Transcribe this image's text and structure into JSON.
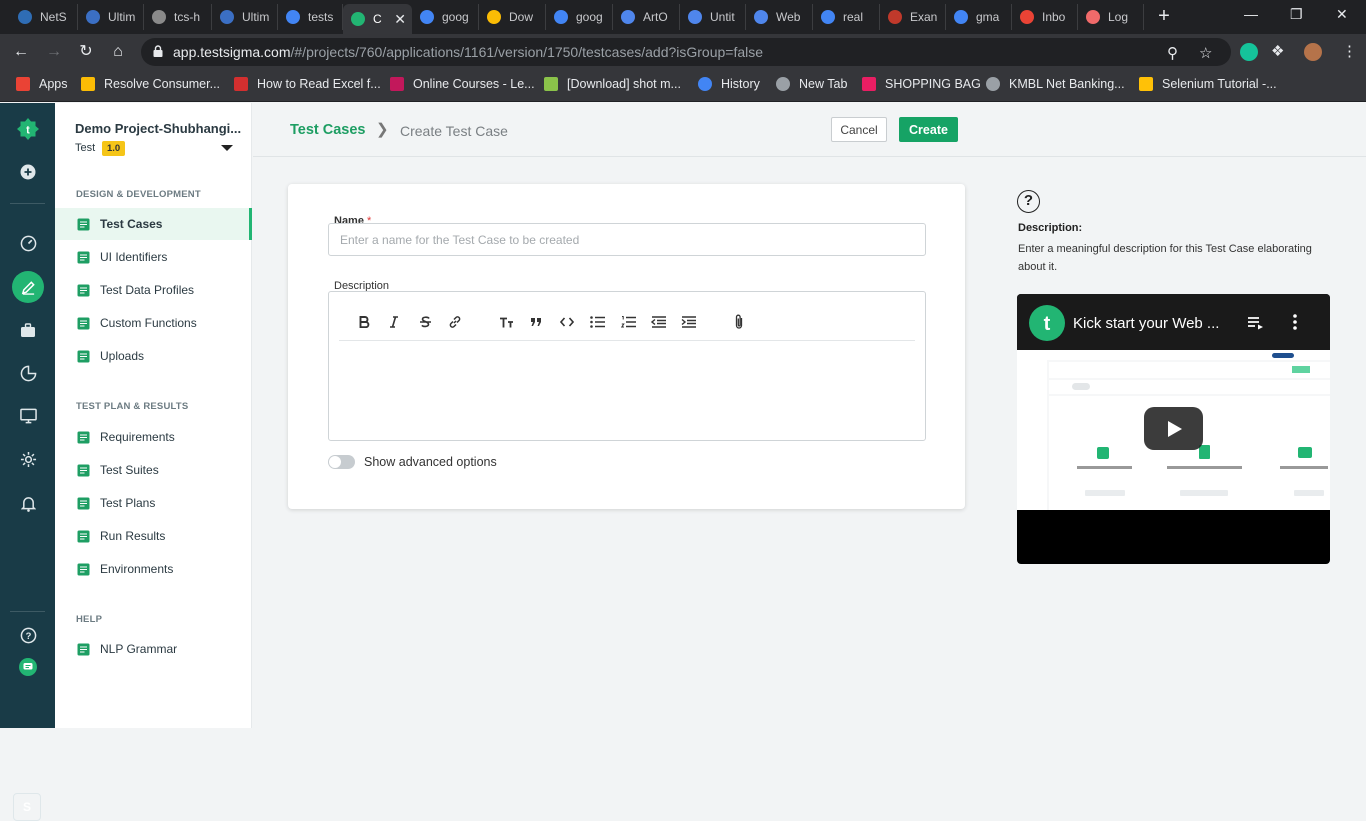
{
  "browser": {
    "tabs": [
      {
        "title": "NetS",
        "favicon_color": "#2f6db5"
      },
      {
        "title": "Ultim",
        "favicon_color": "#3b6fc4"
      },
      {
        "title": "tcs-h",
        "favicon_color": "#8a8a8a"
      },
      {
        "title": "Ultim",
        "favicon_color": "#3b6fc4"
      },
      {
        "title": "tests",
        "favicon_color": "#4285f4"
      },
      {
        "title": "C",
        "favicon_color": "#22b573",
        "active": true
      },
      {
        "title": "goog",
        "favicon_color": "#4285f4"
      },
      {
        "title": "Dow",
        "favicon_color": "#fbbc05"
      },
      {
        "title": "goog",
        "favicon_color": "#4285f4"
      },
      {
        "title": "ArtO",
        "favicon_color": "#4f86ec"
      },
      {
        "title": "Untit",
        "favicon_color": "#4f86ec"
      },
      {
        "title": "Web",
        "favicon_color": "#4f86ec"
      },
      {
        "title": "real",
        "favicon_color": "#4285f4"
      },
      {
        "title": "Exan",
        "favicon_color": "#c0392b"
      },
      {
        "title": "gma",
        "favicon_color": "#4285f4"
      },
      {
        "title": "Inbo",
        "favicon_color": "#ea4335"
      },
      {
        "title": "Log",
        "favicon_color": "#f06a6a"
      }
    ],
    "url_host": "app.testsigma.com",
    "url_path": "/#/projects/760/applications/1161/version/1750/testcases/add?isGroup=false",
    "bookmarks": [
      {
        "label": "Apps",
        "icon_color": "#ea4335"
      },
      {
        "label": "Resolve Consumer...",
        "icon_color": "#fbbc05"
      },
      {
        "label": "How to Read Excel f...",
        "icon_color": "#d32f2f"
      },
      {
        "label": "Online Courses - Le...",
        "icon_color": "#c2185b"
      },
      {
        "label": "[Download] shot m...",
        "icon_color": "#8bc34a"
      },
      {
        "label": "History",
        "icon_color": "#4285f4"
      },
      {
        "label": "New Tab",
        "icon_color": "#9aa0a6"
      },
      {
        "label": "SHOPPING BAG",
        "icon_color": "#e91e63"
      },
      {
        "label": "KMBL Net Banking...",
        "icon_color": "#9aa0a6"
      },
      {
        "label": "Selenium Tutorial -...",
        "icon_color": "#ffc107"
      }
    ]
  },
  "project": {
    "name": "Demo Project-Shubhangi...",
    "type": "Test",
    "version": "1.0"
  },
  "sidebar": {
    "sections": [
      {
        "title": "DESIGN & DEVELOPMENT",
        "items": [
          {
            "label": "Test Cases",
            "icon": "test-cases-icon",
            "active": true
          },
          {
            "label": "UI Identifiers",
            "icon": "ui-identifiers-icon"
          },
          {
            "label": "Test Data Profiles",
            "icon": "test-data-profiles-icon"
          },
          {
            "label": "Custom Functions",
            "icon": "custom-functions-icon"
          },
          {
            "label": "Uploads",
            "icon": "uploads-icon"
          }
        ]
      },
      {
        "title": "TEST PLAN & RESULTS",
        "items": [
          {
            "label": "Requirements",
            "icon": "requirements-icon"
          },
          {
            "label": "Test Suites",
            "icon": "test-suites-icon"
          },
          {
            "label": "Test Plans",
            "icon": "test-plans-icon"
          },
          {
            "label": "Run Results",
            "icon": "run-results-icon"
          },
          {
            "label": "Environments",
            "icon": "environments-icon"
          }
        ]
      },
      {
        "title": "HELP",
        "items": [
          {
            "label": "NLP Grammar",
            "icon": "nlp-grammar-icon"
          }
        ]
      }
    ]
  },
  "header": {
    "breadcrumb_root": "Test Cases",
    "breadcrumb_current": "Create Test Case",
    "cancel_label": "Cancel",
    "create_label": "Create"
  },
  "form": {
    "name_label": "Name",
    "name_required_mark": "*",
    "name_placeholder": "Enter a name for the Test Case to be created",
    "name_value": "",
    "description_label": "Description",
    "description_value": "",
    "toolbar": [
      "bold-icon",
      "italic-icon",
      "strikethrough-icon",
      "link-icon",
      "heading-icon",
      "quote-icon",
      "code-icon",
      "bulleted-list-icon",
      "numbered-list-icon",
      "outdent-icon",
      "indent-icon",
      "attachment-icon"
    ],
    "advanced_label": "Show advanced options",
    "advanced_on": false
  },
  "help": {
    "icon_glyph": "?",
    "title": "Description:",
    "text": "Enter a meaningful description for this Test Case elaborating about it.",
    "video_title": "Kick start your Web ..."
  },
  "colors": {
    "brand_green": "#22b573",
    "create_button": "#16a365",
    "rail": "#193b47",
    "required": "#e03535"
  }
}
